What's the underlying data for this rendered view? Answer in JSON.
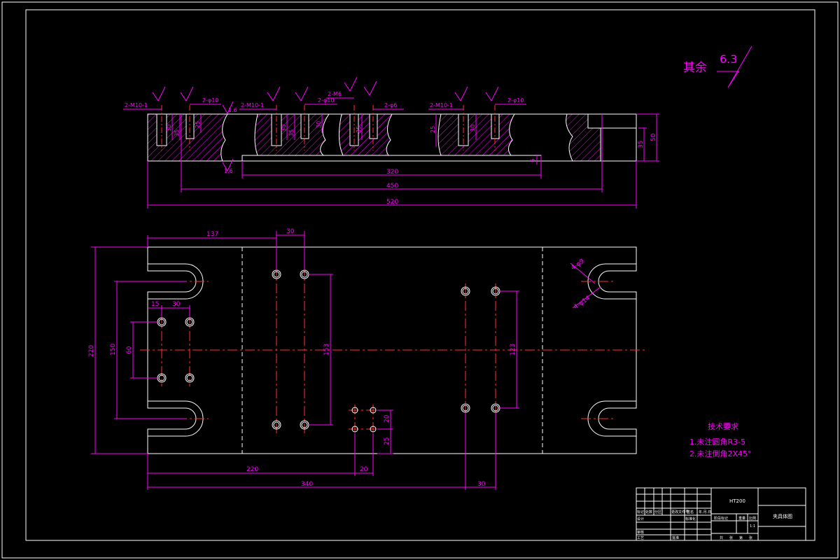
{
  "roughness": {
    "label": "其余",
    "value": "6.3"
  },
  "section_view": {
    "callouts": [
      "2-M10-1",
      "2-φ10",
      "2-M10-1",
      "2-φ10",
      "2-M6",
      "2-φ6",
      "2-M10-1",
      "2-φ10"
    ],
    "finish_marks": [
      "1.6",
      "1.6"
    ],
    "small_marks": [
      "3.2",
      "1.6"
    ],
    "depth_dims": [
      "30",
      "35",
      "25",
      "30",
      "35",
      "30",
      "35",
      "25",
      "30",
      "35",
      "15"
    ],
    "dims": {
      "d320": "320",
      "d450": "450",
      "d520": "520",
      "d35": "35",
      "d50": "50",
      "d5": "5"
    }
  },
  "plan_view": {
    "dims": {
      "d137": "137",
      "d30_top": "30",
      "d15": "15",
      "d30_left": "30",
      "d220_v": "220",
      "d150": "150",
      "d60": "60",
      "d153": "153",
      "d123": "123",
      "d20_v": "20",
      "d25_v": "25",
      "d220_h": "220",
      "d20_h": "20",
      "d340": "340",
      "d30_bot": "30",
      "hole1": "4-φ9",
      "hole2": "4-φ14"
    }
  },
  "tech_requirements": {
    "title": "技术要求",
    "items": [
      "1.未注圆角R3-5",
      "2.未注倒角2X45°"
    ]
  },
  "title_block": {
    "material": "HT200",
    "name": "夹具体图",
    "scale": "1:1",
    "cells": [
      "标记",
      "处数",
      "分区",
      "更改文件号",
      "签名",
      "年.月.日",
      "设计",
      "标准化",
      "阶段标记",
      "重量",
      "比例",
      "审核",
      "工艺",
      "批准",
      "共",
      "张",
      "第",
      "张"
    ]
  }
}
